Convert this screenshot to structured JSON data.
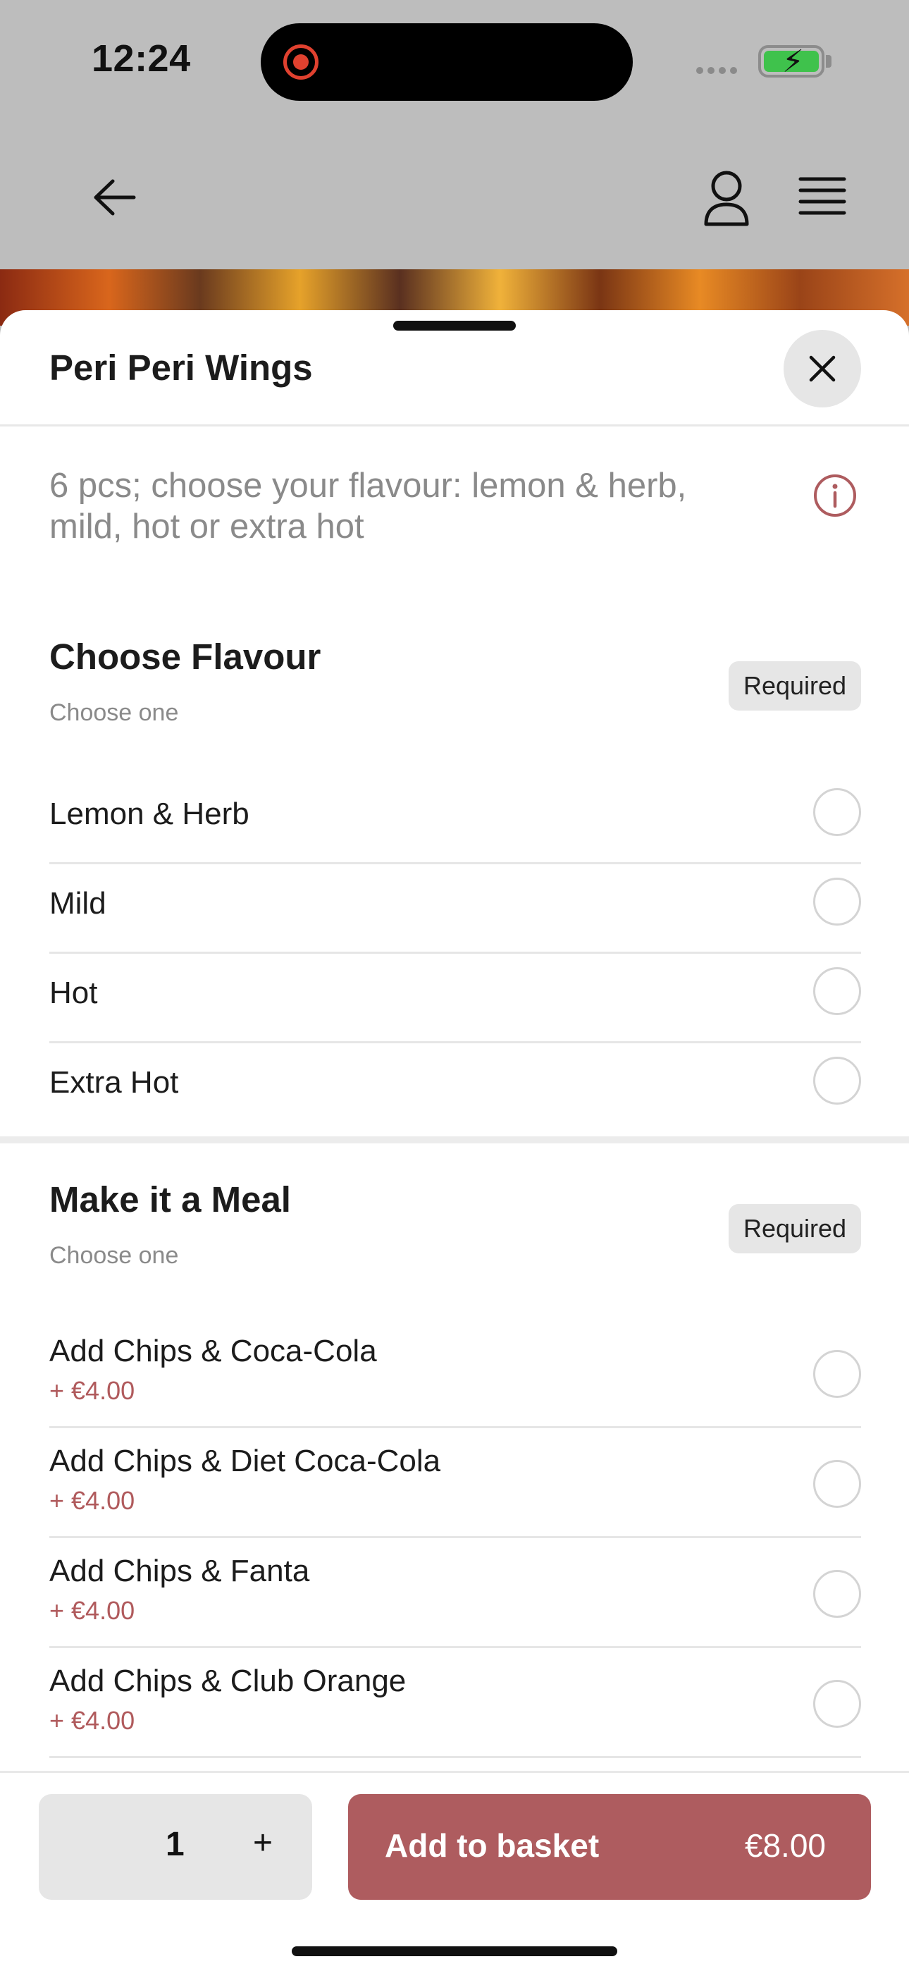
{
  "status_bar": {
    "time": "12:24"
  },
  "sheet": {
    "title": "Peri Peri Wings",
    "description": "6 pcs; choose your flavour: lemon & herb, mild, hot or extra hot"
  },
  "sections": [
    {
      "title": "Choose Flavour",
      "subtitle": "Choose one",
      "badge": "Required",
      "options": [
        {
          "label": "Lemon & Herb"
        },
        {
          "label": "Mild"
        },
        {
          "label": "Hot"
        },
        {
          "label": "Extra Hot"
        }
      ]
    },
    {
      "title": "Make it a Meal",
      "subtitle": "Choose one",
      "badge": "Required",
      "options": [
        {
          "label": "Add Chips & Coca-Cola",
          "price": "+ €4.00"
        },
        {
          "label": "Add Chips & Diet Coca-Cola",
          "price": "+ €4.00"
        },
        {
          "label": "Add Chips & Fanta",
          "price": "+ €4.00"
        },
        {
          "label": "Add Chips & Club Orange",
          "price": "+ €4.00"
        }
      ]
    }
  ],
  "footer": {
    "quantity": "1",
    "plus": "+",
    "add_label": "Add to basket",
    "add_price": "€8.00"
  },
  "colors": {
    "accent": "#ae5c5f",
    "price_text": "#b05a5c",
    "overlay": "#bdbdbd"
  },
  "icons": [
    "back-arrow-icon",
    "user-icon",
    "menu-icon",
    "close-icon",
    "info-icon",
    "record-icon",
    "battery-charging-icon"
  ]
}
